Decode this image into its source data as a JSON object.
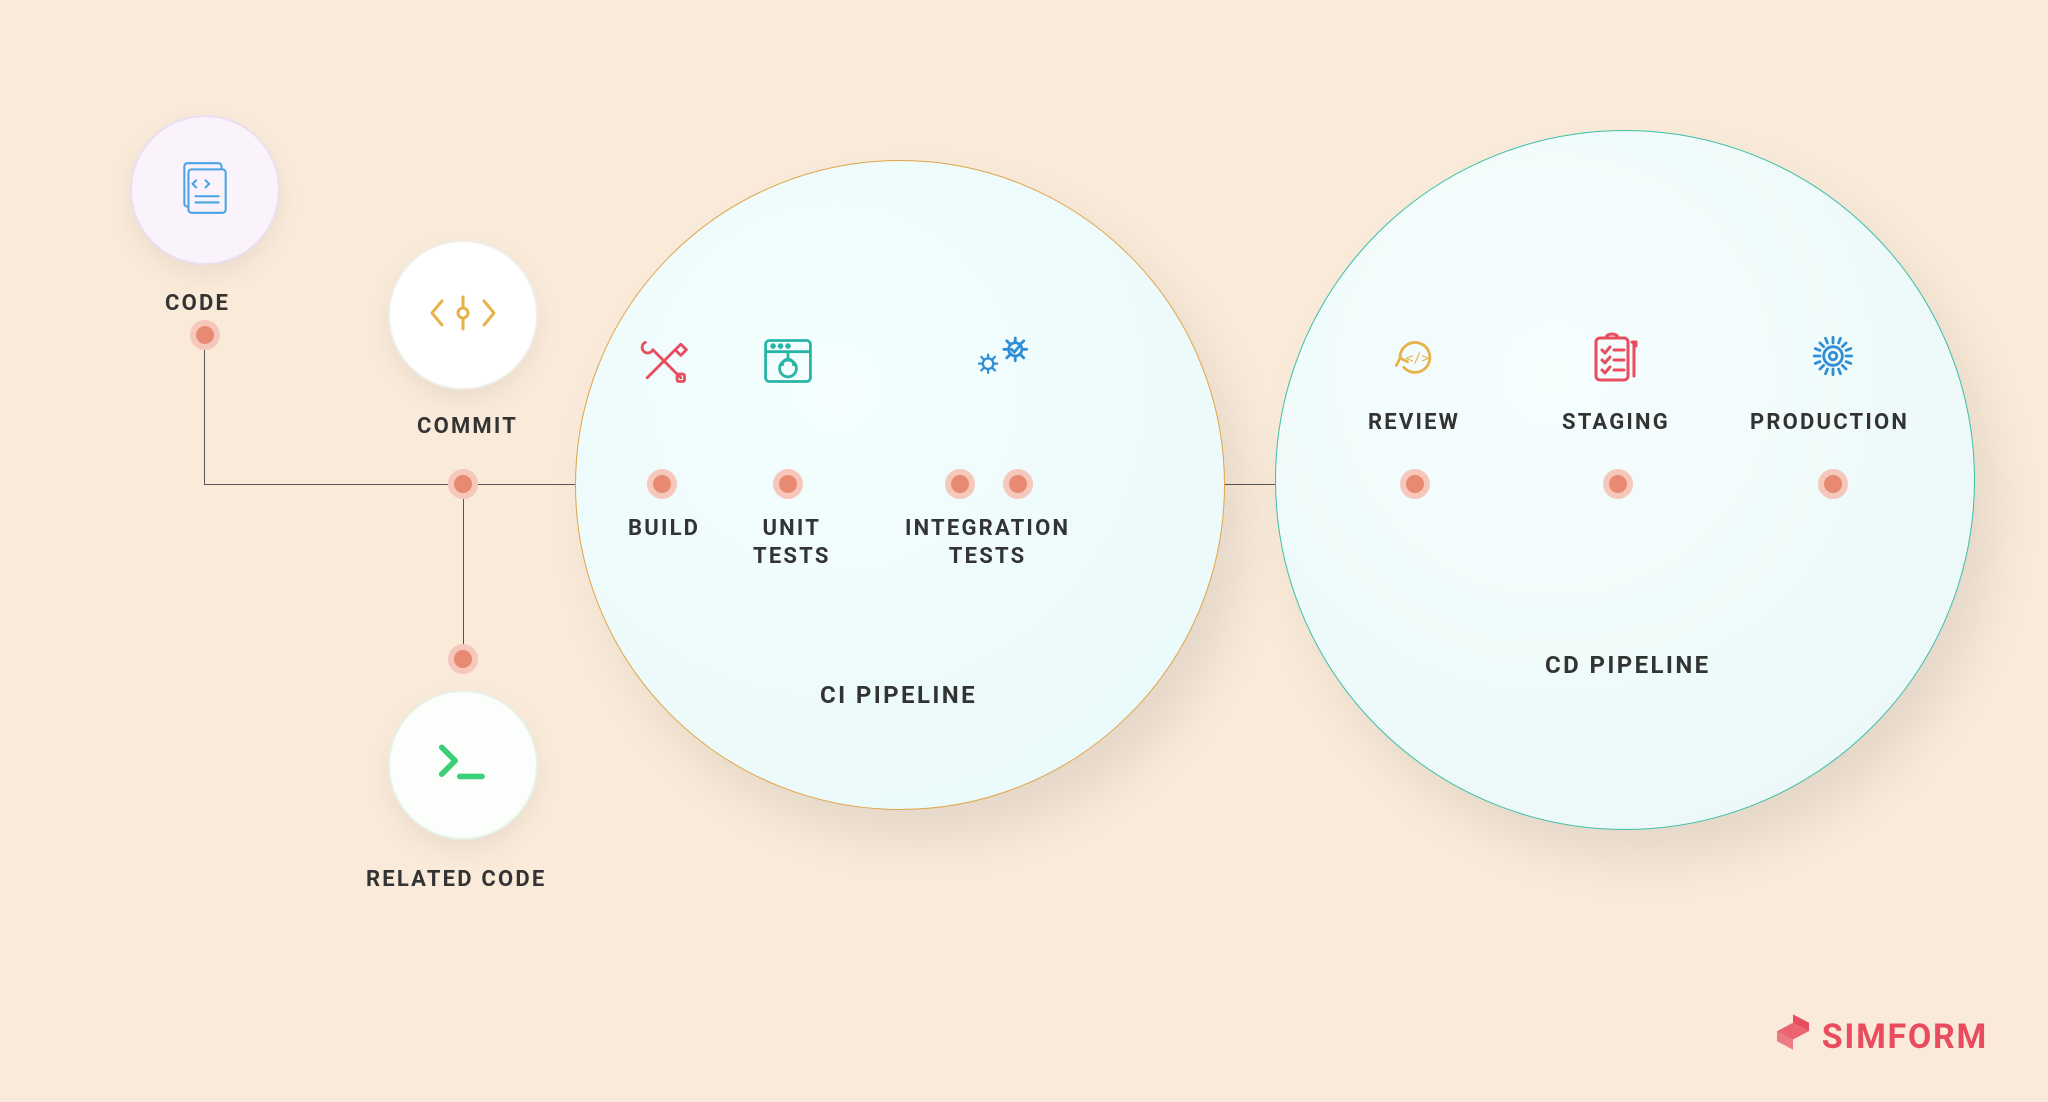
{
  "nodes": {
    "code": "CODE",
    "commit": "COMMIT",
    "related_code": "RELATED CODE",
    "build": "BUILD",
    "unit_tests": "UNIT\nTESTS",
    "integration_tests": "INTEGRATION\nTESTS",
    "review": "REVIEW",
    "staging": "STAGING",
    "production": "PRODUCTION"
  },
  "groups": {
    "ci": "CI PIPELINE",
    "cd": "CD PIPELINE"
  },
  "brand": "SIMFORM",
  "colors": {
    "bg": "#f9ead9",
    "node_dot": "#e88a72",
    "ci_border": "#e0a44a",
    "cd_border": "#3cbfa6",
    "brand": "#e84c5e"
  }
}
